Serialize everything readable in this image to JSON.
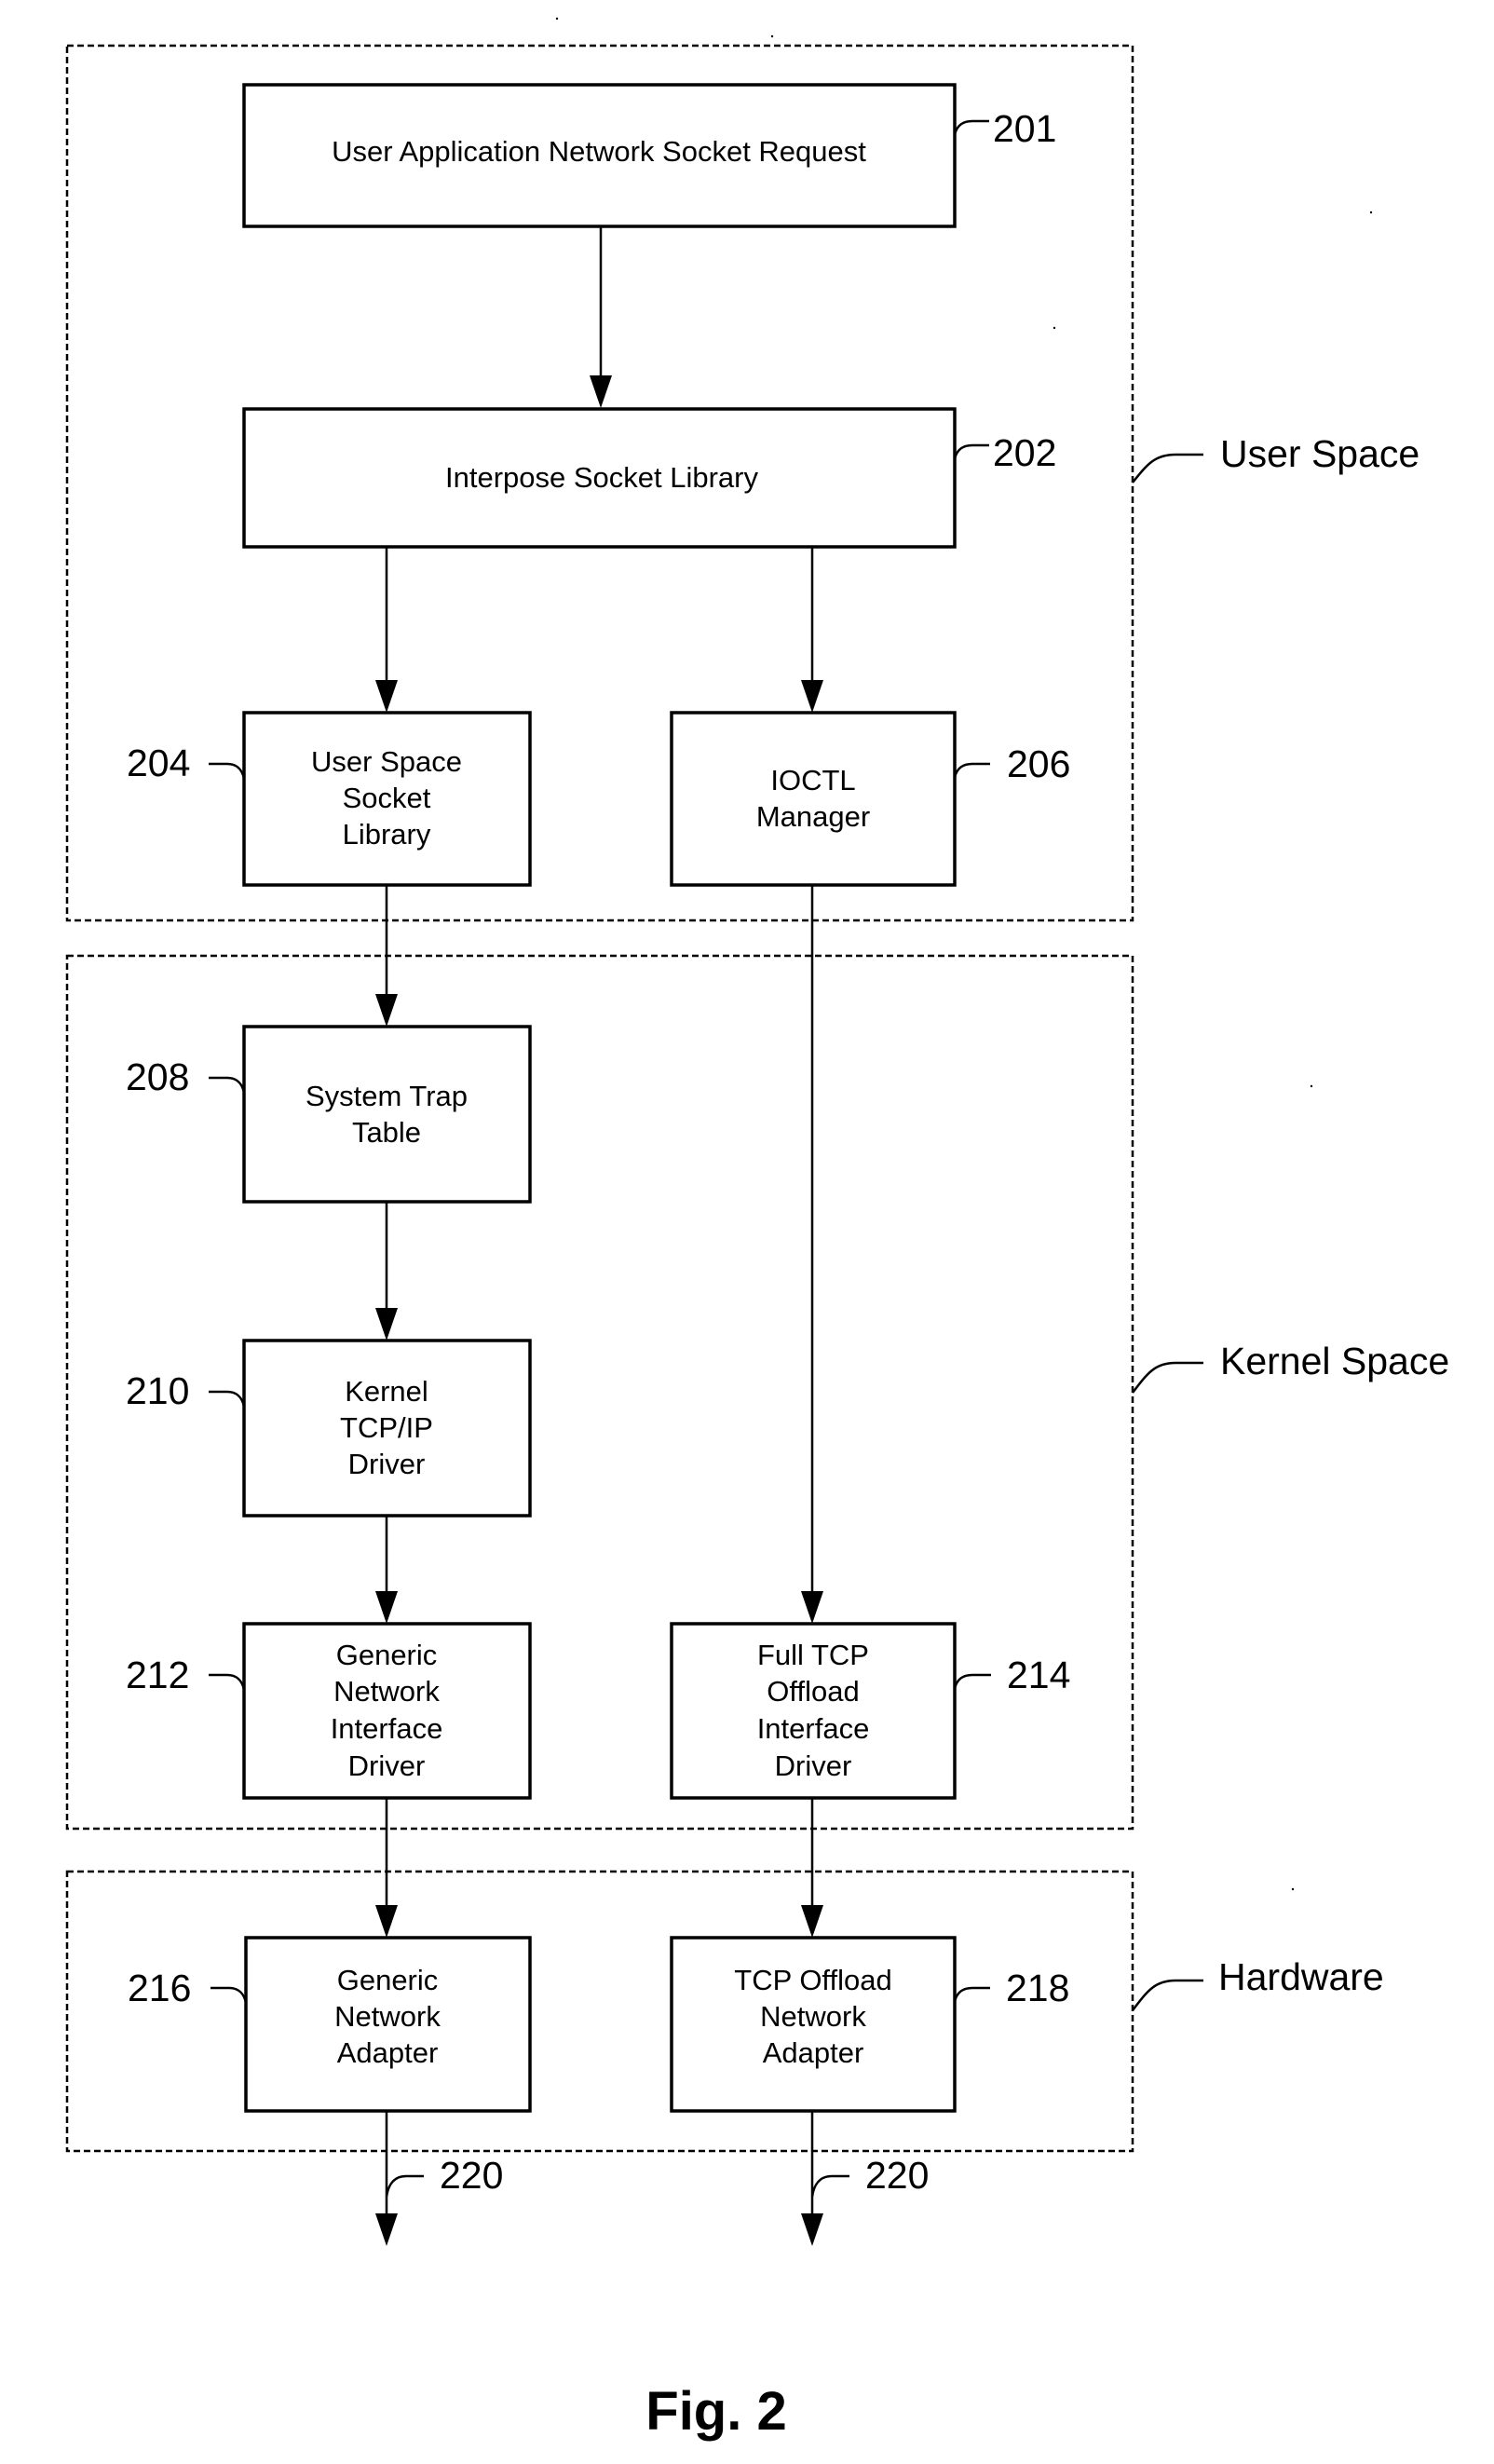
{
  "figure": {
    "caption": "Fig. 2"
  },
  "regions": {
    "user_space": "User Space",
    "kernel_space": "Kernel Space",
    "hardware": "Hardware"
  },
  "blocks": {
    "b201": {
      "ref": "201",
      "lines": [
        "User Application Network Socket Request"
      ]
    },
    "b202": {
      "ref": "202",
      "lines": [
        "Interpose Socket Library"
      ]
    },
    "b204": {
      "ref": "204",
      "lines": [
        "User Space",
        "Socket",
        "Library"
      ]
    },
    "b206": {
      "ref": "206",
      "lines": [
        "IOCTL",
        "Manager"
      ]
    },
    "b208": {
      "ref": "208",
      "lines": [
        "System Trap",
        "Table"
      ]
    },
    "b210": {
      "ref": "210",
      "lines": [
        "Kernel",
        "TCP/IP",
        "Driver"
      ]
    },
    "b212": {
      "ref": "212",
      "lines": [
        "Generic",
        "Network",
        "Interface",
        "Driver"
      ]
    },
    "b214": {
      "ref": "214",
      "lines": [
        "Full TCP",
        "Offload",
        "Interface",
        "Driver"
      ]
    },
    "b216": {
      "ref": "216",
      "lines": [
        "Generic",
        "Network",
        "Adapter"
      ]
    },
    "b218": {
      "ref": "218",
      "lines": [
        "TCP Offload",
        "Network",
        "Adapter"
      ]
    }
  },
  "outputs": {
    "left_ref": "220",
    "right_ref": "220"
  }
}
